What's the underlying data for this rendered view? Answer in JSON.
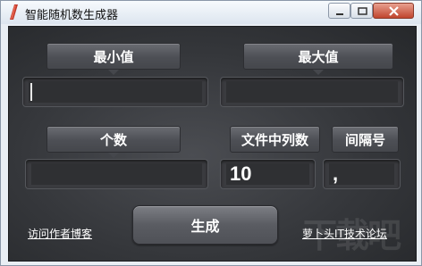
{
  "window": {
    "title": "智能随机数生成器"
  },
  "labels": {
    "min": "最小值",
    "max": "最大值",
    "count": "个数",
    "file_columns": "文件中列数",
    "separator": "间隔号"
  },
  "fields": {
    "min_value": "",
    "max_value": "",
    "count_value": "",
    "file_columns_value": "10",
    "separator_value": ","
  },
  "buttons": {
    "generate": "生成"
  },
  "links": {
    "visit_blog": "访问作者博客",
    "forum": "萝卜头IT技术论坛"
  },
  "watermark": "下载吧",
  "colors": {
    "close_button": "#c0452e",
    "client_bg": "#35373b"
  }
}
